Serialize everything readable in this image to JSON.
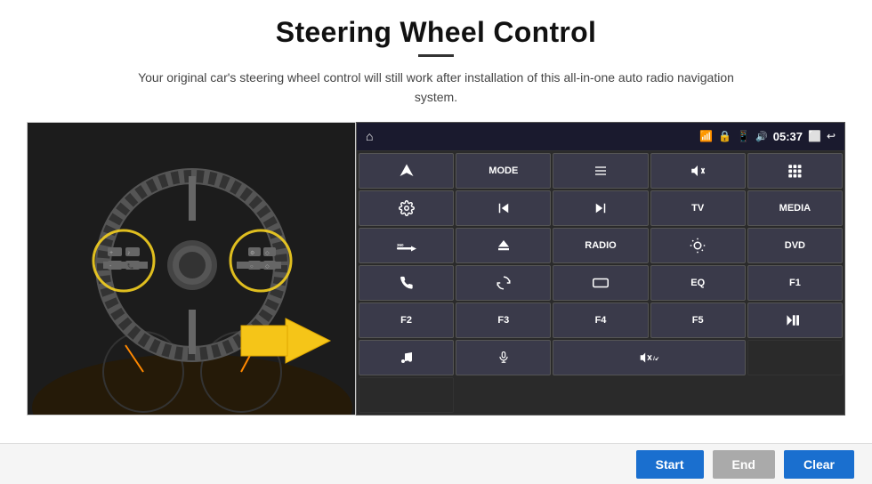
{
  "header": {
    "title": "Steering Wheel Control",
    "subtitle": "Your original car's steering wheel control will still work after installation of this all-in-one auto radio navigation system."
  },
  "topbar": {
    "time": "05:37"
  },
  "grid_buttons": [
    {
      "id": "btn-nav",
      "label": "▲",
      "icon": "nav",
      "row": 1,
      "col": 1,
      "type": "icon"
    },
    {
      "id": "btn-mode",
      "label": "MODE",
      "row": 1,
      "col": 2
    },
    {
      "id": "btn-list",
      "label": "☰",
      "row": 1,
      "col": 3,
      "type": "icon"
    },
    {
      "id": "btn-mute",
      "label": "🔇",
      "row": 1,
      "col": 4,
      "type": "icon"
    },
    {
      "id": "btn-apps",
      "label": "⠿",
      "row": 1,
      "col": 5,
      "type": "icon"
    },
    {
      "id": "btn-settings",
      "label": "⚙",
      "row": 2,
      "col": 1,
      "type": "icon"
    },
    {
      "id": "btn-prev",
      "label": "⏮",
      "row": 2,
      "col": 2,
      "type": "icon"
    },
    {
      "id": "btn-next",
      "label": "⏭",
      "row": 2,
      "col": 3,
      "type": "icon"
    },
    {
      "id": "btn-tv",
      "label": "TV",
      "row": 2,
      "col": 4
    },
    {
      "id": "btn-media",
      "label": "MEDIA",
      "row": 2,
      "col": 5
    },
    {
      "id": "btn-360",
      "label": "360",
      "row": 3,
      "col": 1
    },
    {
      "id": "btn-eject",
      "label": "⏏",
      "row": 3,
      "col": 2,
      "type": "icon"
    },
    {
      "id": "btn-radio",
      "label": "RADIO",
      "row": 3,
      "col": 3
    },
    {
      "id": "btn-bright",
      "label": "☀",
      "row": 3,
      "col": 4,
      "type": "icon"
    },
    {
      "id": "btn-dvd",
      "label": "DVD",
      "row": 3,
      "col": 5
    },
    {
      "id": "btn-phone",
      "label": "📞",
      "row": 4,
      "col": 1,
      "type": "icon"
    },
    {
      "id": "btn-swipe",
      "label": "↺",
      "row": 4,
      "col": 2,
      "type": "icon"
    },
    {
      "id": "btn-rect",
      "label": "▭",
      "row": 4,
      "col": 3,
      "type": "icon"
    },
    {
      "id": "btn-eq",
      "label": "EQ",
      "row": 4,
      "col": 4
    },
    {
      "id": "btn-f1",
      "label": "F1",
      "row": 4,
      "col": 5
    },
    {
      "id": "btn-f2",
      "label": "F2",
      "row": 5,
      "col": 1
    },
    {
      "id": "btn-f3",
      "label": "F3",
      "row": 5,
      "col": 2
    },
    {
      "id": "btn-f4",
      "label": "F4",
      "row": 5,
      "col": 3
    },
    {
      "id": "btn-f5",
      "label": "F5",
      "row": 5,
      "col": 4
    },
    {
      "id": "btn-playpause",
      "label": "▶⏸",
      "row": 5,
      "col": 5,
      "type": "icon"
    },
    {
      "id": "btn-music",
      "label": "♪",
      "row": 6,
      "col": 1,
      "type": "icon"
    },
    {
      "id": "btn-mic",
      "label": "🎤",
      "row": 6,
      "col": 2,
      "type": "icon"
    },
    {
      "id": "btn-vol",
      "label": "🔊/↙",
      "row": 6,
      "col": 3,
      "type": "icon",
      "span": 2
    }
  ],
  "bottom_buttons": {
    "start": "Start",
    "end": "End",
    "clear": "Clear"
  },
  "colors": {
    "accent_blue": "#1a6fcf",
    "panel_dark": "#1a1a2e",
    "btn_bg": "#3a3a4a",
    "btn_border": "#555555"
  }
}
